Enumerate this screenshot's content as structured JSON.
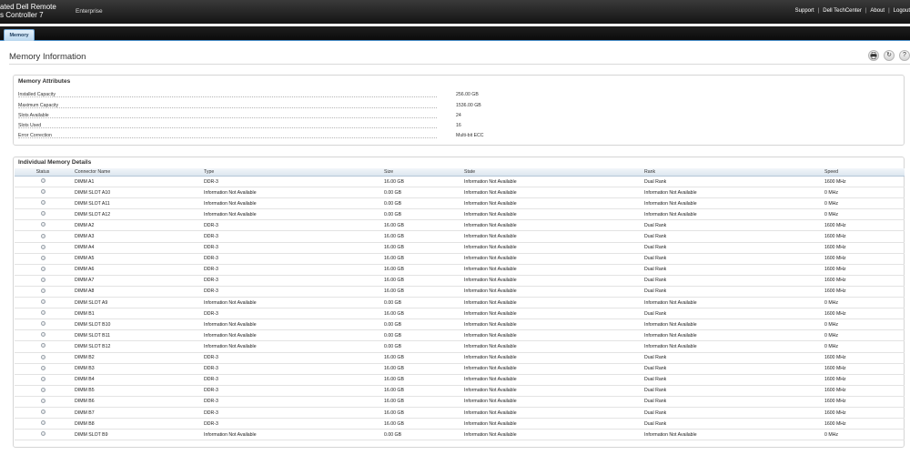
{
  "header": {
    "brand_line1": "ated Dell Remote",
    "brand_line2": "s Controller 7",
    "edition": "Enterprise",
    "links": [
      "Support",
      "Dell TechCenter",
      "About",
      "Logout"
    ]
  },
  "tabs": [
    {
      "label": "Memory",
      "active": true
    }
  ],
  "page": {
    "title": "Memory Information",
    "icons": [
      "print-icon",
      "refresh-icon",
      "help-icon"
    ]
  },
  "attributes": {
    "title": "Memory Attributes",
    "rows": [
      {
        "label": "Installed Capacity",
        "value": "256.00 GB"
      },
      {
        "label": "Maximum Capacity",
        "value": "1536.00 GB"
      },
      {
        "label": "Slots Available",
        "value": "24"
      },
      {
        "label": "Slots Used",
        "value": "16"
      },
      {
        "label": "Error Correction",
        "value": "Multi-bit ECC"
      }
    ]
  },
  "details": {
    "title": "Individual Memory Details",
    "columns": [
      "Status",
      "Connector Name",
      "Type",
      "Size",
      "State",
      "Rank",
      "Speed"
    ],
    "rows": [
      [
        "",
        "DIMM A1",
        "DDR-3",
        "16.00 GB",
        "Information Not Available",
        "Dual Rank",
        "1600 MHz"
      ],
      [
        "",
        "DIMM SLOT A10",
        "Information Not Available",
        "0.00 GB",
        "Information Not Available",
        "Information Not Available",
        "0 MHz"
      ],
      [
        "",
        "DIMM SLOT A11",
        "Information Not Available",
        "0.00 GB",
        "Information Not Available",
        "Information Not Available",
        "0 MHz"
      ],
      [
        "",
        "DIMM SLOT A12",
        "Information Not Available",
        "0.00 GB",
        "Information Not Available",
        "Information Not Available",
        "0 MHz"
      ],
      [
        "",
        "DIMM A2",
        "DDR-3",
        "16.00 GB",
        "Information Not Available",
        "Dual Rank",
        "1600 MHz"
      ],
      [
        "",
        "DIMM A3",
        "DDR-3",
        "16.00 GB",
        "Information Not Available",
        "Dual Rank",
        "1600 MHz"
      ],
      [
        "",
        "DIMM A4",
        "DDR-3",
        "16.00 GB",
        "Information Not Available",
        "Dual Rank",
        "1600 MHz"
      ],
      [
        "",
        "DIMM A5",
        "DDR-3",
        "16.00 GB",
        "Information Not Available",
        "Dual Rank",
        "1600 MHz"
      ],
      [
        "",
        "DIMM A6",
        "DDR-3",
        "16.00 GB",
        "Information Not Available",
        "Dual Rank",
        "1600 MHz"
      ],
      [
        "",
        "DIMM A7",
        "DDR-3",
        "16.00 GB",
        "Information Not Available",
        "Dual Rank",
        "1600 MHz"
      ],
      [
        "",
        "DIMM A8",
        "DDR-3",
        "16.00 GB",
        "Information Not Available",
        "Dual Rank",
        "1600 MHz"
      ],
      [
        "",
        "DIMM SLOT A9",
        "Information Not Available",
        "0.00 GB",
        "Information Not Available",
        "Information Not Available",
        "0 MHz"
      ],
      [
        "",
        "DIMM B1",
        "DDR-3",
        "16.00 GB",
        "Information Not Available",
        "Dual Rank",
        "1600 MHz"
      ],
      [
        "",
        "DIMM SLOT B10",
        "Information Not Available",
        "0.00 GB",
        "Information Not Available",
        "Information Not Available",
        "0 MHz"
      ],
      [
        "",
        "DIMM SLOT B11",
        "Information Not Available",
        "0.00 GB",
        "Information Not Available",
        "Information Not Available",
        "0 MHz"
      ],
      [
        "",
        "DIMM SLOT B12",
        "Information Not Available",
        "0.00 GB",
        "Information Not Available",
        "Information Not Available",
        "0 MHz"
      ],
      [
        "",
        "DIMM B2",
        "DDR-3",
        "16.00 GB",
        "Information Not Available",
        "Dual Rank",
        "1600 MHz"
      ],
      [
        "",
        "DIMM B3",
        "DDR-3",
        "16.00 GB",
        "Information Not Available",
        "Dual Rank",
        "1600 MHz"
      ],
      [
        "",
        "DIMM B4",
        "DDR-3",
        "16.00 GB",
        "Information Not Available",
        "Dual Rank",
        "1600 MHz"
      ],
      [
        "",
        "DIMM B5",
        "DDR-3",
        "16.00 GB",
        "Information Not Available",
        "Dual Rank",
        "1600 MHz"
      ],
      [
        "",
        "DIMM B6",
        "DDR-3",
        "16.00 GB",
        "Information Not Available",
        "Dual Rank",
        "1600 MHz"
      ],
      [
        "",
        "DIMM B7",
        "DDR-3",
        "16.00 GB",
        "Information Not Available",
        "Dual Rank",
        "1600 MHz"
      ],
      [
        "",
        "DIMM B8",
        "DDR-3",
        "16.00 GB",
        "Information Not Available",
        "Dual Rank",
        "1600 MHz"
      ],
      [
        "",
        "DIMM SLOT B9",
        "Information Not Available",
        "0.00 GB",
        "Information Not Available",
        "Information Not Available",
        "0 MHz"
      ]
    ]
  }
}
